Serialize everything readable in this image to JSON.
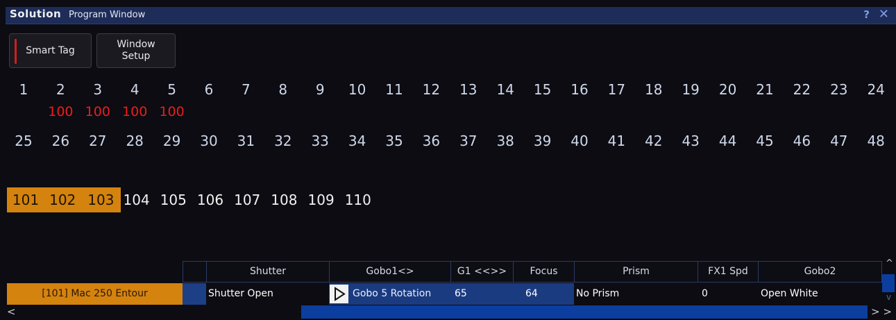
{
  "window": {
    "logo": "Solution",
    "title": "Program Window",
    "help": "?",
    "close": "✕"
  },
  "toolbar": {
    "smart_tag": "Smart Tag",
    "window_setup_line1": "Window",
    "window_setup_line2": "Setup"
  },
  "channels_row1": [
    "1",
    "2",
    "3",
    "4",
    "5",
    "6",
    "7",
    "8",
    "9",
    "10",
    "11",
    "12",
    "13",
    "14",
    "15",
    "16",
    "17",
    "18",
    "19",
    "20",
    "21",
    "22",
    "23",
    "24"
  ],
  "levels_row1": [
    "",
    "100",
    "100",
    "100",
    "100"
  ],
  "channels_row2": [
    "25",
    "26",
    "27",
    "28",
    "29",
    "30",
    "31",
    "32",
    "33",
    "34",
    "35",
    "36",
    "37",
    "38",
    "39",
    "40",
    "41",
    "42",
    "43",
    "44",
    "45",
    "46",
    "47",
    "48"
  ],
  "groups": [
    {
      "label": "101",
      "selected": true
    },
    {
      "label": "102",
      "selected": true
    },
    {
      "label": "103",
      "selected": true
    },
    {
      "label": "104",
      "selected": false
    },
    {
      "label": "105",
      "selected": false
    },
    {
      "label": "106",
      "selected": false
    },
    {
      "label": "107",
      "selected": false
    },
    {
      "label": "108",
      "selected": false
    },
    {
      "label": "109",
      "selected": false
    },
    {
      "label": "110",
      "selected": false
    }
  ],
  "sheet": {
    "headers": [
      "Shutter",
      "Gobo1<>",
      "G1 <<>>",
      "Focus",
      "Prism",
      "FX1 Spd",
      "Gobo2"
    ],
    "row": {
      "fixture": "[101] Mac 250 Entour",
      "shutter": "Shutter Open",
      "gobo1": "Gobo 5 Rotation",
      "g1": "65",
      "focus": "64",
      "prism": "No Prism",
      "fx1spd": "0",
      "gobo2": "Open White"
    }
  },
  "scroll": {
    "left": "<",
    "right": "> >",
    "up": "^",
    "down": "v"
  },
  "colors": {
    "title_bar": "#1d2c58",
    "selected_group": "#d4830e",
    "level_red": "#ee1c1c",
    "scroll_blue": "#0c3ea0"
  }
}
